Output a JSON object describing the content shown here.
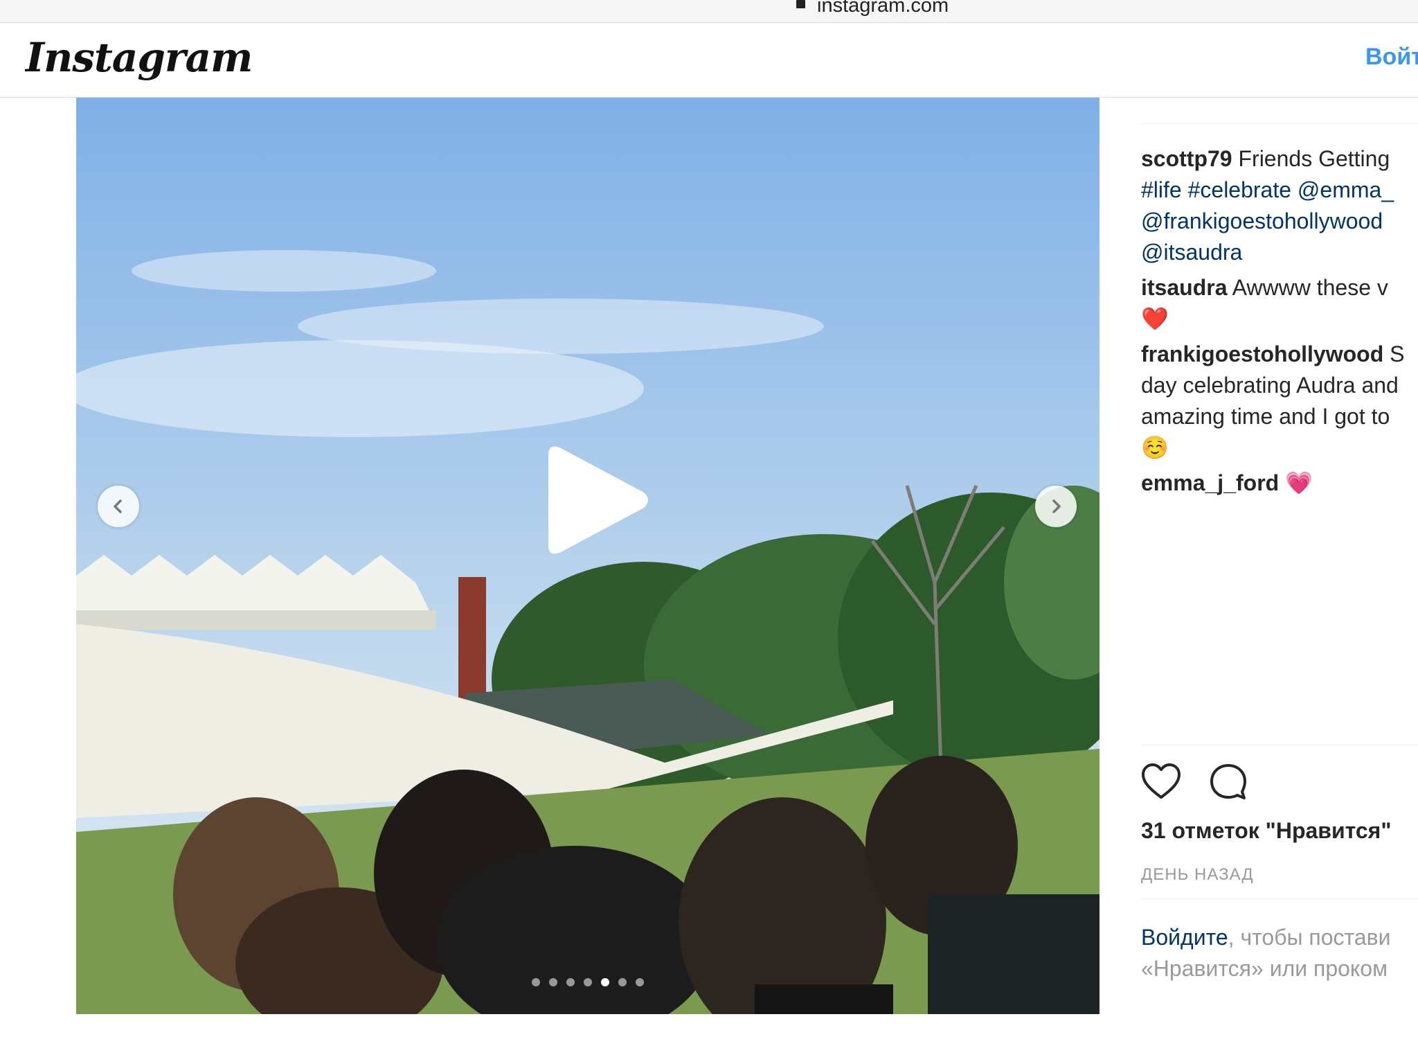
{
  "browser": {
    "url": "instagram.com"
  },
  "header": {
    "logo": "Instagram",
    "login_label": "Войт"
  },
  "media": {
    "type": "video",
    "carousel_count": 7,
    "carousel_active": 5
  },
  "post": {
    "caption": {
      "user": "scottp79",
      "lines": [
        "Friends Getting",
        "#life #celebrate @emma_",
        "@frankigoestohollywood",
        "@itsaudra"
      ]
    },
    "comments": [
      {
        "user": "itsaudra",
        "lines": [
          "Awwww these v",
          "❤️"
        ]
      },
      {
        "user": "frankigoestohollywood",
        "lines": [
          "S",
          "day celebrating Audra and",
          "amazing time and I got to",
          "☺️"
        ]
      },
      {
        "user": "emma_j_ford",
        "lines": [
          "💗"
        ]
      }
    ],
    "likes": "31 отметок \"Нравится\"",
    "timestamp": "ДЕНЬ НАЗАД",
    "login_prompt": {
      "link": "Войдите",
      "line1": ", чтобы постави",
      "line2": "«Нравится» или проком"
    }
  },
  "colors": {
    "link_blue": "#003569",
    "accent_blue": "#3897f0",
    "muted": "#999999"
  }
}
